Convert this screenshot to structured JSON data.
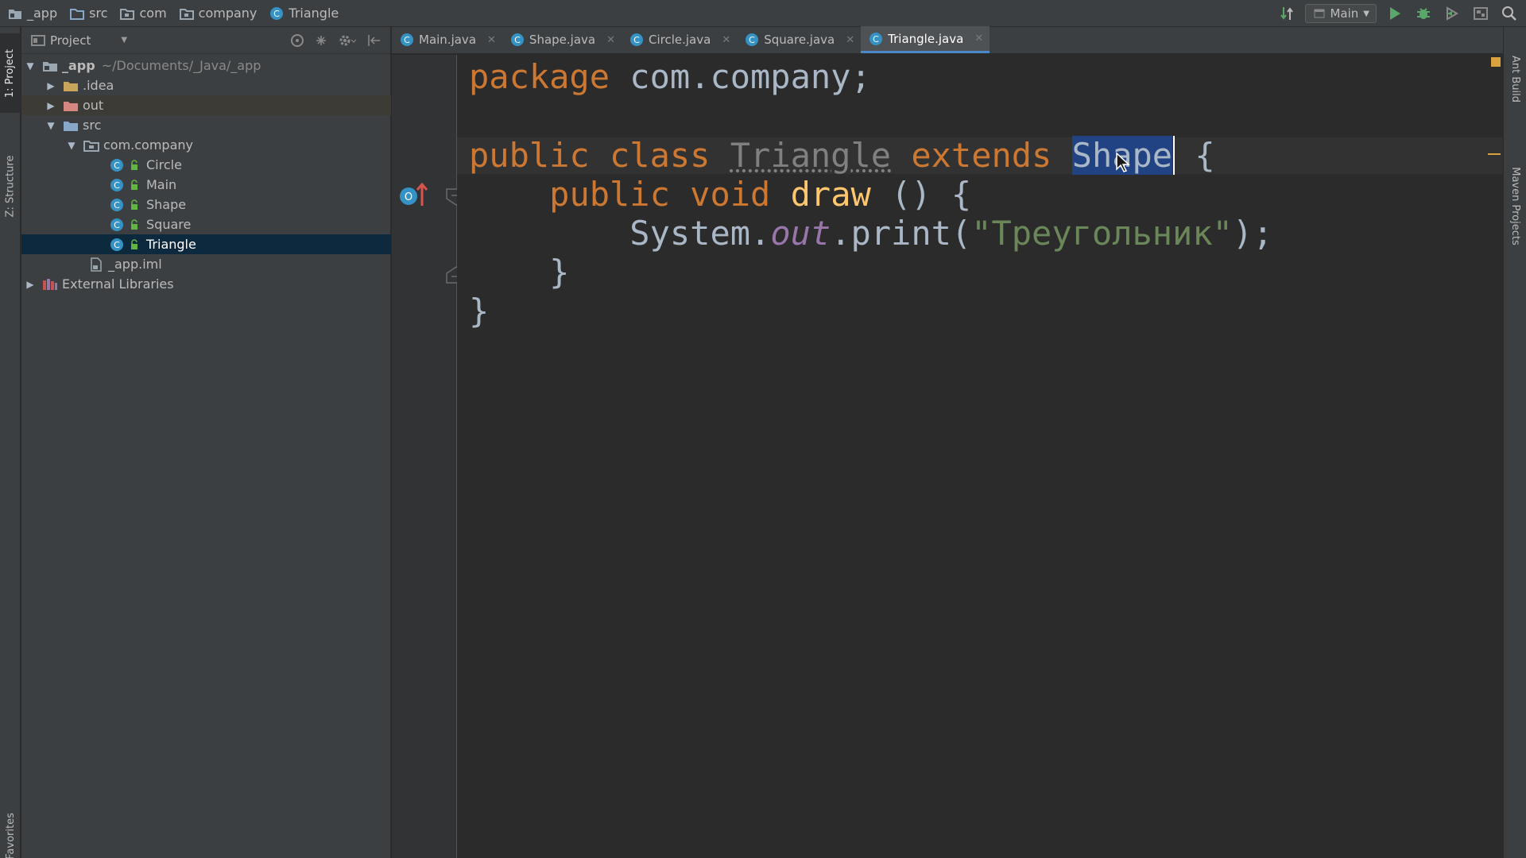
{
  "breadcrumb": [
    {
      "label": "_app",
      "icon": "project-folder-icon"
    },
    {
      "label": "src",
      "icon": "folder-icon"
    },
    {
      "label": "com",
      "icon": "package-icon"
    },
    {
      "label": "company",
      "icon": "package-icon"
    },
    {
      "label": "Triangle",
      "icon": "class-icon"
    }
  ],
  "toolbar": {
    "run_config": "Main",
    "icons": [
      "vcs-update-icon",
      "run-icon",
      "debug-icon",
      "coverage-icon",
      "project-structure-icon",
      "search-icon"
    ]
  },
  "left_strip": {
    "project_tab": "1: Project",
    "structure_tab": "Z: Structure",
    "favorites_tab": "Favorites"
  },
  "right_strip": {
    "ant_tab": "Ant Build",
    "maven_tab": "Maven Projects"
  },
  "project_panel": {
    "title": "Project",
    "tree": [
      {
        "label": "_app",
        "hint": "~/Documents/_Java/_app",
        "depth": 0,
        "arrow": "down",
        "kind": "module"
      },
      {
        "label": ".idea",
        "depth": 1,
        "arrow": "right",
        "kind": "folder"
      },
      {
        "label": "out",
        "depth": 1,
        "arrow": "right",
        "kind": "excluded-folder"
      },
      {
        "label": "src",
        "depth": 1,
        "arrow": "down",
        "kind": "source-folder"
      },
      {
        "label": "com.company",
        "depth": 2,
        "arrow": "down",
        "kind": "package"
      },
      {
        "label": "Circle",
        "depth": 3,
        "kind": "class"
      },
      {
        "label": "Main",
        "depth": 3,
        "kind": "class"
      },
      {
        "label": "Shape",
        "depth": 3,
        "kind": "class"
      },
      {
        "label": "Square",
        "depth": 3,
        "kind": "class"
      },
      {
        "label": "Triangle",
        "depth": 3,
        "kind": "class",
        "selected": true
      },
      {
        "label": "_app.iml",
        "depth": 2,
        "kind": "iml"
      },
      {
        "label": "External Libraries",
        "depth": 0,
        "arrow": "right",
        "kind": "libraries"
      }
    ]
  },
  "tabs": [
    {
      "label": "Main.java",
      "active": false
    },
    {
      "label": "Shape.java",
      "active": false
    },
    {
      "label": "Circle.java",
      "active": false
    },
    {
      "label": "Square.java",
      "active": false
    },
    {
      "label": "Triangle.java",
      "active": true
    }
  ],
  "code": {
    "line1_kw": "package",
    "line1_rest": " com.company;",
    "line3_public": "public",
    "line3_class": "class",
    "line3_name": "Triangle",
    "line3_extends": "extends",
    "line3_parent": "Shape",
    "line3_brace": " {",
    "line4_public": "public",
    "line4_void": "void",
    "line4_method": "draw",
    "line4_rest": " () {",
    "line5_system": "System.",
    "line5_out": "out",
    "line5_print": ".print(",
    "line5_string": "\"Треугольник\"",
    "line5_end": ");",
    "line6": "}",
    "line7": "}"
  },
  "colors": {
    "keyword": "#cc7832",
    "string": "#6a8759",
    "method": "#ffc66d",
    "field": "#9876aa",
    "selection": "#214283"
  }
}
